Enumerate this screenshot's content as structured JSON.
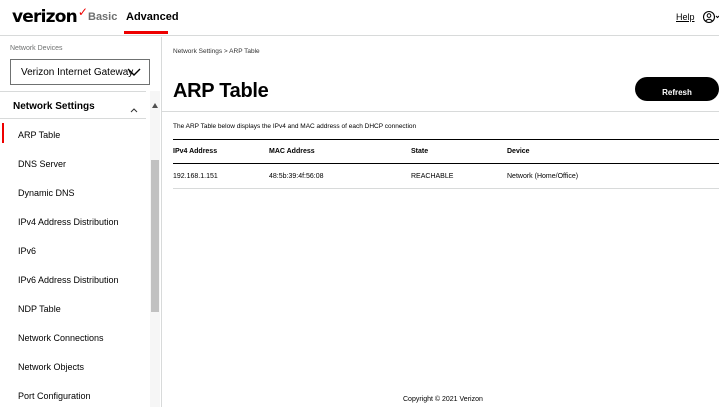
{
  "header": {
    "brand": "verizon",
    "brand_mark": "✓",
    "nav_basic": "Basic",
    "nav_advanced": "Advanced",
    "help": "Help",
    "account_icon": "account-circle-icon",
    "accent_color": "#ee0000"
  },
  "sidebar": {
    "device_label": "Network Devices",
    "device_selected": "Verizon Internet Gateway",
    "section_title": "Network Settings",
    "items": [
      {
        "label": "ARP Table",
        "active": true
      },
      {
        "label": "DNS Server"
      },
      {
        "label": "Dynamic DNS"
      },
      {
        "label": "IPv4 Address Distribution"
      },
      {
        "label": "IPv6"
      },
      {
        "label": "IPv6 Address Distribution"
      },
      {
        "label": "NDP Table"
      },
      {
        "label": "Network Connections"
      },
      {
        "label": "Network Objects"
      },
      {
        "label": "Port Configuration"
      }
    ]
  },
  "main": {
    "breadcrumb": "Network Settings  >  ARP Table",
    "title": "ARP Table",
    "refresh_label": "Refresh",
    "description": "The ARP Table below displays the IPv4 and MAC address of each DHCP connection",
    "table": {
      "headers": [
        "IPv4 Address",
        "MAC Address",
        "State",
        "Device"
      ],
      "rows": [
        [
          "192.168.1.151",
          "48:5b:39:4f:56:08",
          "REACHABLE",
          "Network (Home/Office)"
        ]
      ]
    }
  },
  "footer": {
    "copyright": "Copyright © 2021 Verizon"
  }
}
